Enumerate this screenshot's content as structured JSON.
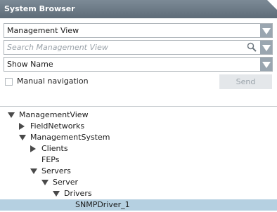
{
  "window": {
    "title": "System Browser"
  },
  "view_select": {
    "value": "Management View"
  },
  "search": {
    "placeholder": "Search Management View"
  },
  "display_select": {
    "value": "Show Name"
  },
  "manual_navigation": {
    "label": "Manual navigation",
    "checked": false
  },
  "send_button": {
    "label": "Send",
    "enabled": false
  },
  "tree": {
    "nodes": [
      {
        "label": "ManagementView",
        "level": 0,
        "expander": "expanded",
        "selected": false
      },
      {
        "label": "FieldNetworks",
        "level": 1,
        "expander": "collapsed",
        "selected": false
      },
      {
        "label": "ManagementSystem",
        "level": 1,
        "expander": "expanded",
        "selected": false
      },
      {
        "label": "Clients",
        "level": 2,
        "expander": "collapsed",
        "selected": false
      },
      {
        "label": "FEPs",
        "level": 2,
        "expander": "none",
        "selected": false
      },
      {
        "label": "Servers",
        "level": 2,
        "expander": "expanded",
        "selected": false
      },
      {
        "label": "Server",
        "level": 3,
        "expander": "expanded",
        "selected": false
      },
      {
        "label": "Drivers",
        "level": 4,
        "expander": "expanded",
        "selected": false
      },
      {
        "label": "SNMPDriver_1",
        "level": 5,
        "expander": "none",
        "selected": true
      }
    ]
  },
  "colors": {
    "titlebar": "#6b7985",
    "selection": "#b5d0e1",
    "dropdown_button": "#9aa6b0"
  }
}
